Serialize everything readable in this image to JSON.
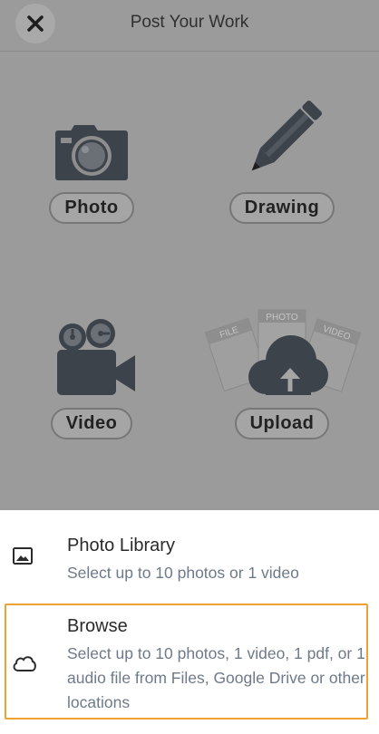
{
  "header": {
    "title": "Post Your Work",
    "close_icon": "close-x-icon"
  },
  "options": [
    {
      "label": "Photo",
      "icon": "camera-icon"
    },
    {
      "label": "Drawing",
      "icon": "pencil-icon"
    },
    {
      "label": "Video",
      "icon": "video-camera-icon"
    },
    {
      "label": "Upload",
      "icon": "cloud-upload-icon"
    }
  ],
  "upload_art": {
    "file_card": "FILE",
    "photo_card": "PHOTO",
    "video_card": "VIDEO"
  },
  "sheet": {
    "items": [
      {
        "label": "Photo Library",
        "description": "Select up to 10 photos or 1 video",
        "icon": "image-icon"
      },
      {
        "label": "Browse",
        "description": "Select up to 10 photos, 1 video, 1 pdf, or 1 audio file from Files, Google Drive or other locations",
        "icon": "cloud-icon"
      }
    ]
  },
  "colors": {
    "overlay_bg": "#9b9b9b",
    "icon_dark": "#3c434b",
    "highlight": "#f0a133",
    "desc_text": "#6e7a8a"
  }
}
